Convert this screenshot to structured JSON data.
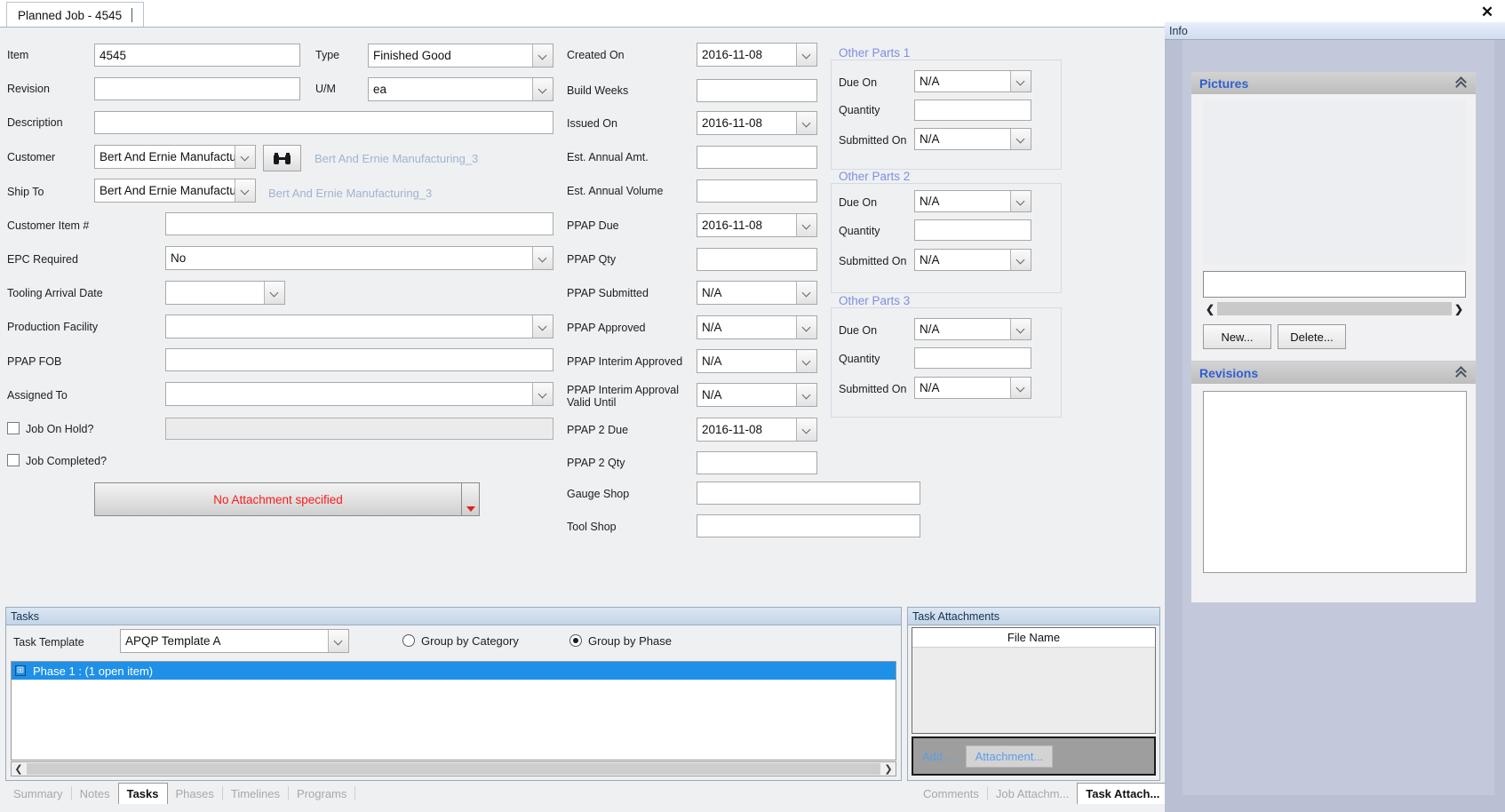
{
  "window": {
    "tab_title": "Planned Job - 4545",
    "close_label": "✕"
  },
  "form": {
    "left": [
      {
        "label": "Item",
        "value": "4545",
        "kind": "text"
      },
      {
        "label": "Revision",
        "value": "",
        "kind": "text"
      },
      {
        "label": "Description",
        "value": "",
        "kind": "text"
      },
      {
        "label": "Customer",
        "value": "Bert And Ernie Manufacturi",
        "kind": "combo",
        "side": "Bert And Ernie Manufacturing_3"
      },
      {
        "label": "Ship To",
        "value": "Bert And Ernie Manufacturi",
        "kind": "combo",
        "side": "Bert And Ernie Manufacturing_3"
      },
      {
        "label": "Customer Item #",
        "value": "",
        "kind": "text"
      },
      {
        "label": "EPC Required",
        "value": "No",
        "kind": "combo"
      },
      {
        "label": "Tooling Arrival Date",
        "value": "",
        "kind": "combo"
      },
      {
        "label": "Production Facility",
        "value": "",
        "kind": "combo"
      },
      {
        "label": "PPAP FOB",
        "value": "",
        "kind": "text"
      },
      {
        "label": "Assigned To",
        "value": "",
        "kind": "combo"
      }
    ],
    "type_label": "Type",
    "type_value": "Finished Good",
    "um_label": "U/M",
    "um_value": "ea",
    "checkboxes": [
      {
        "label": "Job On Hold?",
        "checked": false
      },
      {
        "label": "Job Completed?",
        "checked": false
      }
    ],
    "attachment": {
      "text": "No Attachment specified",
      "color": "#fc1c1c"
    },
    "middle": [
      {
        "label": "Created On",
        "value": "2016-11-08",
        "kind": "combo"
      },
      {
        "label": "Build Weeks",
        "value": "",
        "kind": "text"
      },
      {
        "label": "Issued On",
        "value": "2016-11-08",
        "kind": "combo"
      },
      {
        "label": "Est. Annual Amt.",
        "value": "",
        "kind": "text"
      },
      {
        "label": "Est. Annual Volume",
        "value": "",
        "kind": "text"
      },
      {
        "label": "PPAP Due",
        "value": "2016-11-08",
        "kind": "combo"
      },
      {
        "label": "PPAP Qty",
        "value": "",
        "kind": "text"
      },
      {
        "label": "PPAP Submitted",
        "value": "N/A",
        "kind": "combo"
      },
      {
        "label": "PPAP Approved",
        "value": "N/A",
        "kind": "combo"
      },
      {
        "label": "PPAP Interim Approved",
        "value": "N/A",
        "kind": "combo"
      },
      {
        "label": "PPAP Interim Approval Valid Until",
        "value": "N/A",
        "kind": "combo"
      },
      {
        "label": "PPAP 2 Due",
        "value": "2016-11-08",
        "kind": "combo"
      },
      {
        "label": "PPAP 2 Qty",
        "value": "",
        "kind": "text"
      },
      {
        "label": "Gauge Shop",
        "value": "",
        "kind": "text"
      },
      {
        "label": "Tool Shop",
        "value": "",
        "kind": "text"
      }
    ],
    "other_parts": [
      {
        "title": "Other Parts 1",
        "rows": [
          {
            "label": "Due On",
            "value": "N/A",
            "kind": "combo"
          },
          {
            "label": "Quantity",
            "value": "",
            "kind": "text"
          },
          {
            "label": "Submitted On",
            "value": "N/A",
            "kind": "combo"
          }
        ]
      },
      {
        "title": "Other Parts 2",
        "rows": [
          {
            "label": "Due On",
            "value": "N/A",
            "kind": "combo"
          },
          {
            "label": "Quantity",
            "value": "",
            "kind": "text"
          },
          {
            "label": "Submitted On",
            "value": "N/A",
            "kind": "combo"
          }
        ]
      },
      {
        "title": "Other Parts 3",
        "rows": [
          {
            "label": "Due On",
            "value": "N/A",
            "kind": "combo"
          },
          {
            "label": "Quantity",
            "value": "",
            "kind": "text"
          },
          {
            "label": "Submitted On",
            "value": "N/A",
            "kind": "combo"
          }
        ]
      }
    ]
  },
  "tasks": {
    "panel_title": "Tasks",
    "template_label": "Task Template",
    "template_value": "APQP Template A",
    "radios": [
      {
        "label": "Group by Category",
        "selected": false
      },
      {
        "label": "Group by Phase",
        "selected": true
      }
    ],
    "tree_rows": [
      {
        "label": "Phase 1 : (1 open item)",
        "expander": "⊞"
      }
    ]
  },
  "task_attachments": {
    "panel_title": "Task Attachments",
    "column_header": "File Name",
    "add_label": "Add ...",
    "attachment_button": "Attachment..."
  },
  "bottom_tabs_left": [
    {
      "label": "Summary",
      "active": false
    },
    {
      "label": "Notes",
      "active": false
    },
    {
      "label": "Tasks",
      "active": true
    },
    {
      "label": "Phases",
      "active": false
    },
    {
      "label": "Timelines",
      "active": false
    },
    {
      "label": "Programs",
      "active": false
    }
  ],
  "bottom_tabs_right": [
    {
      "label": "Comments",
      "active": false
    },
    {
      "label": "Job Attachm...",
      "active": false
    },
    {
      "label": "Task Attach...",
      "active": true
    }
  ],
  "info": {
    "tab_label": "Info",
    "pictures": {
      "title": "Pictures",
      "caption_value": "",
      "new_label": "New...",
      "delete_label": "Delete..."
    },
    "revisions": {
      "title": "Revisions"
    }
  },
  "colors": {
    "accent_blue": "#2f5fd0",
    "group_title": "#7e8fe0",
    "selection": "#1e90e8",
    "alert_red": "#fc1c1c",
    "link_blue": "#5b9ee8",
    "side_text": "#9fb4cf"
  }
}
